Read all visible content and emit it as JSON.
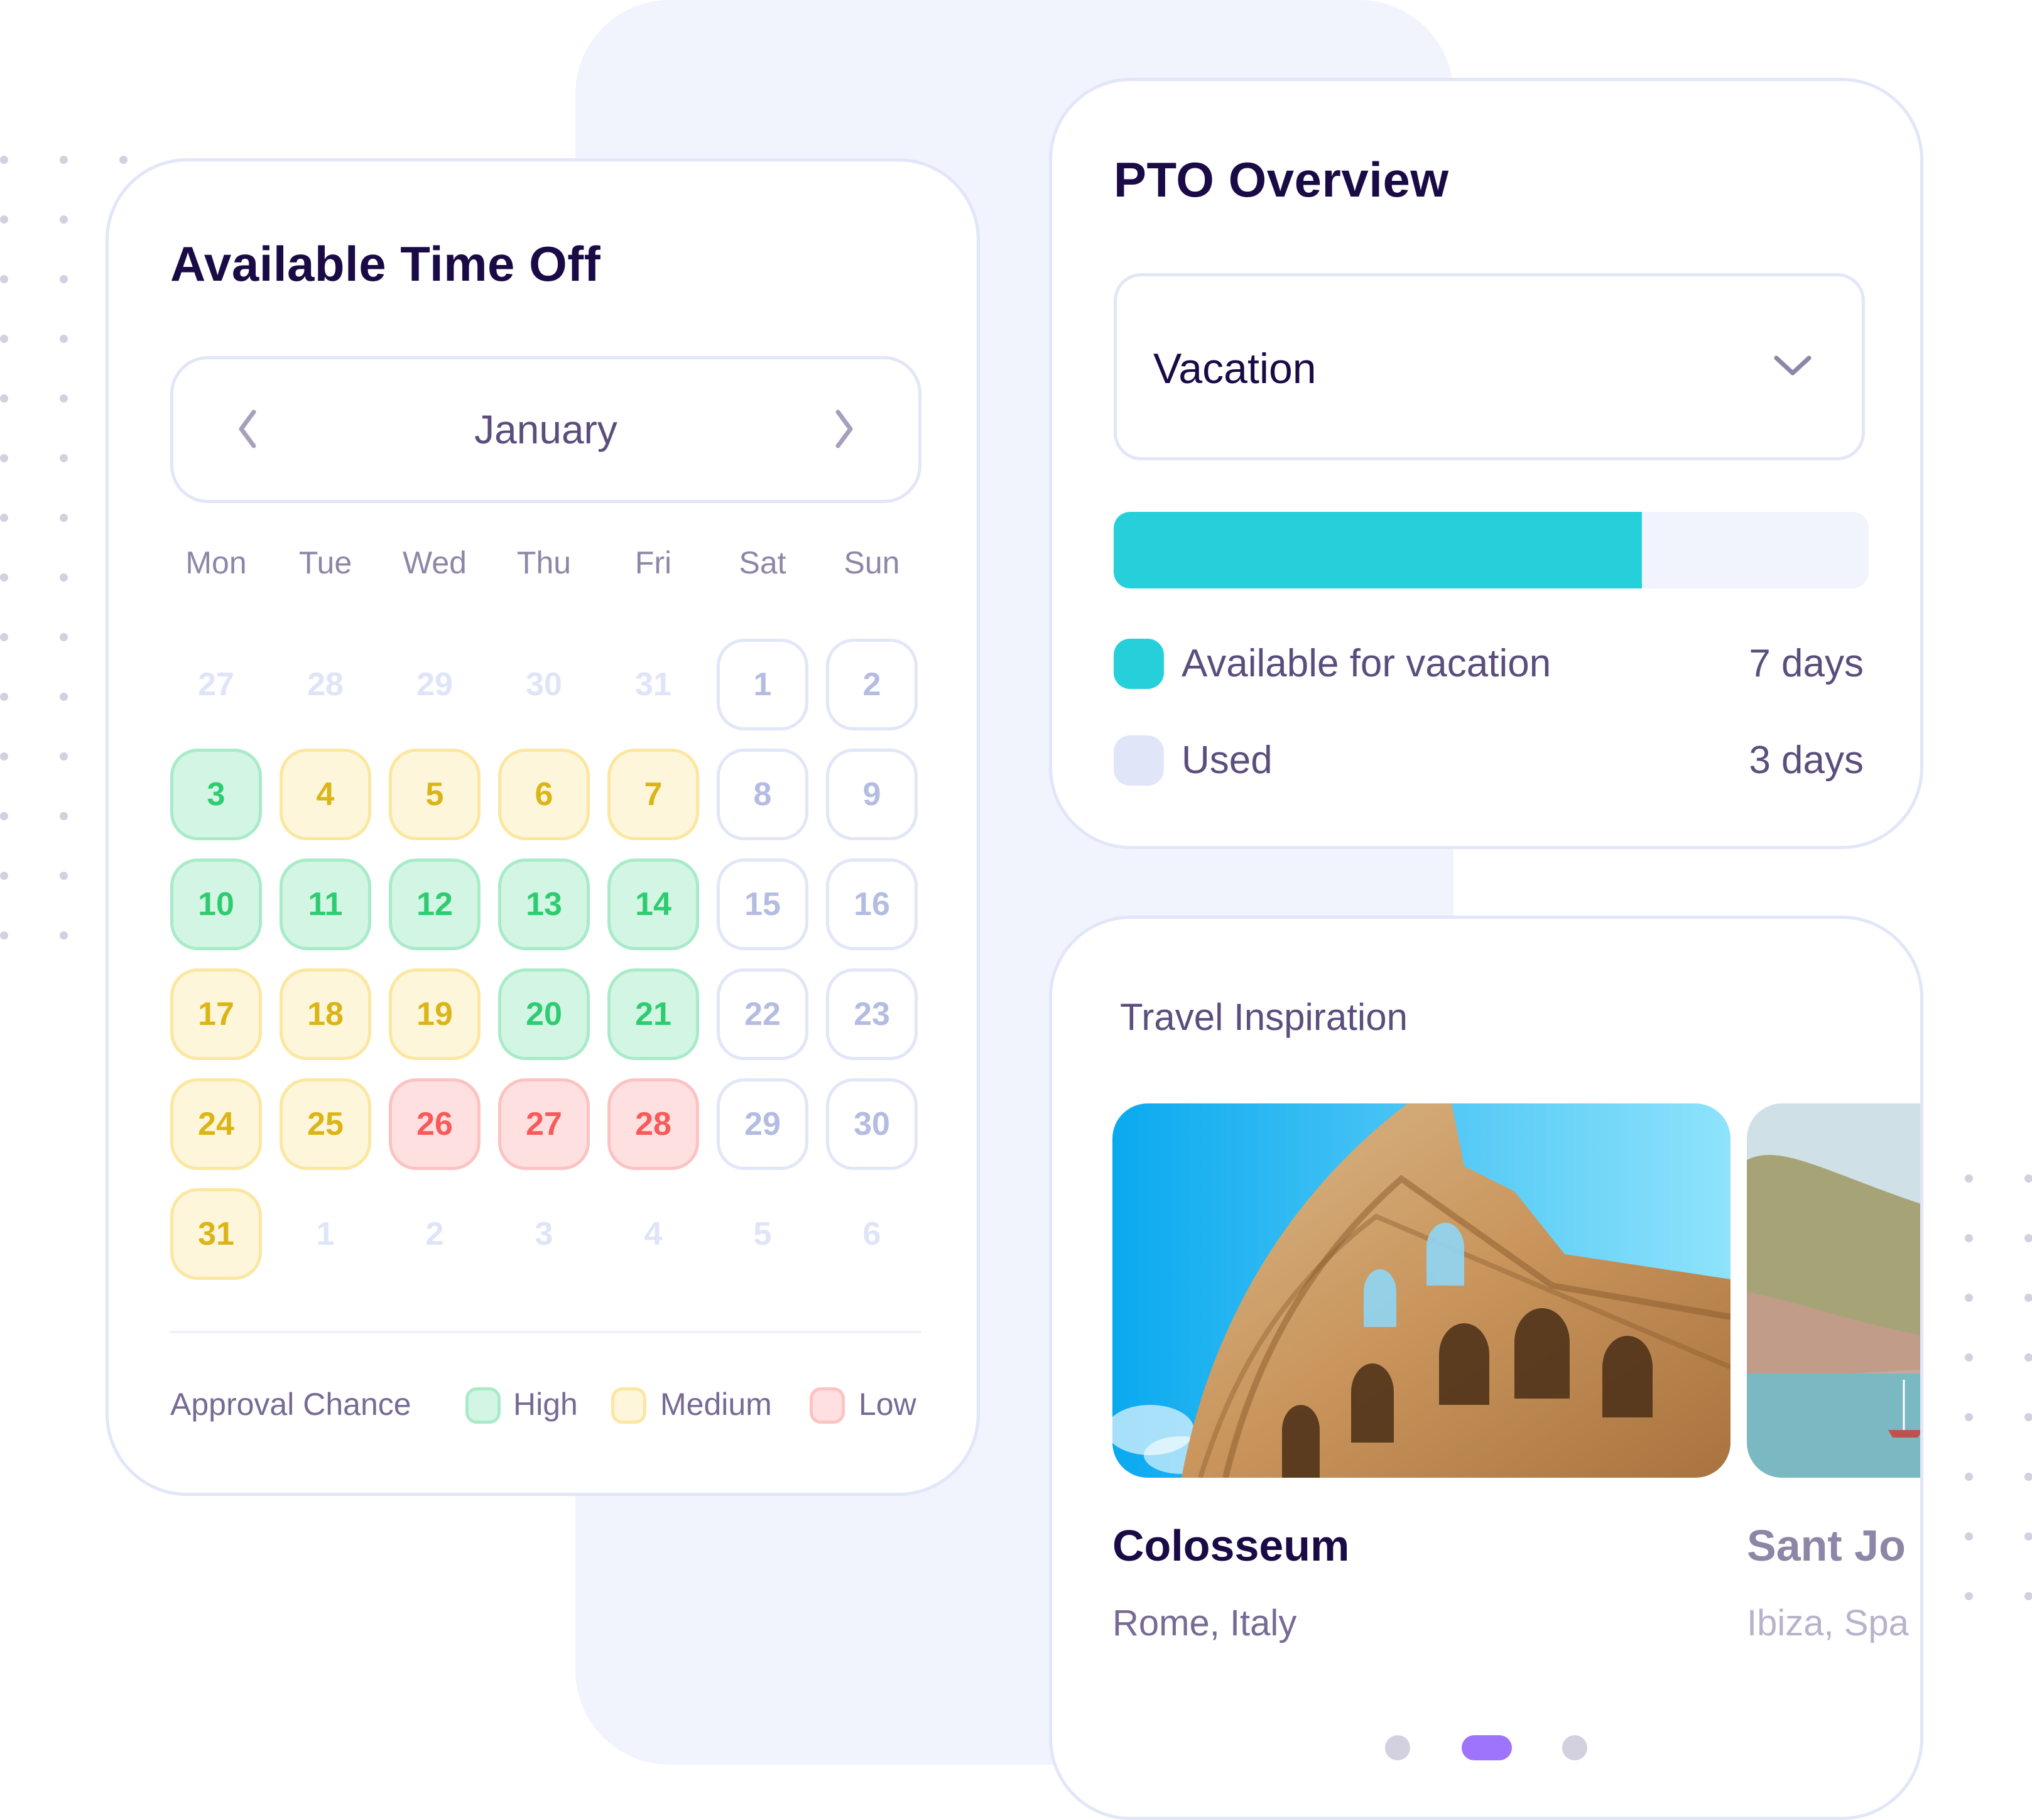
{
  "calendar_card": {
    "title": "Available Time Off",
    "month": "January",
    "prev_icon": "chevron-left-icon",
    "next_icon": "chevron-right-icon",
    "weekdays": [
      "Mon",
      "Tue",
      "Wed",
      "Thu",
      "Fri",
      "Sat",
      "Sun"
    ],
    "weeks": [
      [
        {
          "d": "27",
          "s": "muted"
        },
        {
          "d": "28",
          "s": "muted"
        },
        {
          "d": "29",
          "s": "muted"
        },
        {
          "d": "30",
          "s": "muted"
        },
        {
          "d": "31",
          "s": "muted"
        },
        {
          "d": "1",
          "s": "weekend"
        },
        {
          "d": "2",
          "s": "weekend"
        }
      ],
      [
        {
          "d": "3",
          "s": "high"
        },
        {
          "d": "4",
          "s": "medium"
        },
        {
          "d": "5",
          "s": "medium"
        },
        {
          "d": "6",
          "s": "medium"
        },
        {
          "d": "7",
          "s": "medium"
        },
        {
          "d": "8",
          "s": "weekend"
        },
        {
          "d": "9",
          "s": "weekend"
        }
      ],
      [
        {
          "d": "10",
          "s": "high"
        },
        {
          "d": "11",
          "s": "high"
        },
        {
          "d": "12",
          "s": "high"
        },
        {
          "d": "13",
          "s": "high"
        },
        {
          "d": "14",
          "s": "high"
        },
        {
          "d": "15",
          "s": "weekend"
        },
        {
          "d": "16",
          "s": "weekend"
        }
      ],
      [
        {
          "d": "17",
          "s": "medium"
        },
        {
          "d": "18",
          "s": "medium"
        },
        {
          "d": "19",
          "s": "medium"
        },
        {
          "d": "20",
          "s": "high"
        },
        {
          "d": "21",
          "s": "high"
        },
        {
          "d": "22",
          "s": "weekend"
        },
        {
          "d": "23",
          "s": "weekend"
        }
      ],
      [
        {
          "d": "24",
          "s": "medium"
        },
        {
          "d": "25",
          "s": "medium"
        },
        {
          "d": "26",
          "s": "low"
        },
        {
          "d": "27",
          "s": "low"
        },
        {
          "d": "28",
          "s": "low"
        },
        {
          "d": "29",
          "s": "weekend"
        },
        {
          "d": "30",
          "s": "weekend"
        }
      ],
      [
        {
          "d": "31",
          "s": "medium"
        },
        {
          "d": "1",
          "s": "muted"
        },
        {
          "d": "2",
          "s": "muted"
        },
        {
          "d": "3",
          "s": "muted"
        },
        {
          "d": "4",
          "s": "muted"
        },
        {
          "d": "5",
          "s": "muted"
        },
        {
          "d": "6",
          "s": "muted"
        }
      ]
    ],
    "legend": {
      "title": "Approval Chance",
      "items": [
        {
          "label": "High",
          "level": "high"
        },
        {
          "label": "Medium",
          "level": "medium"
        },
        {
          "label": "Low",
          "level": "low"
        }
      ]
    }
  },
  "pto_card": {
    "title": "PTO Overview",
    "select_value": "Vacation",
    "select_icon": "chevron-down-icon",
    "progress_available_fraction": 0.7,
    "stats": [
      {
        "label": "Available for vacation",
        "value": "7 days",
        "color": "#26d0da"
      },
      {
        "label": "Used",
        "value": "3 days",
        "color": "#e0e5f8"
      }
    ]
  },
  "travel_card": {
    "title": "Travel Inspiration",
    "places": [
      {
        "name": "Colosseum",
        "location": "Rome, Italy",
        "image": "colosseum-photo"
      },
      {
        "name": "Sant Jo",
        "location": "Ibiza, Spa",
        "image": "ibiza-coast-photo"
      }
    ],
    "pager": {
      "count": 3,
      "active_index": 1
    }
  },
  "colors": {
    "title": "#1a0a45",
    "body_text": "#5b4e7d",
    "accent_cyan": "#26d0da",
    "pager_active": "#9d74fb",
    "pager_inactive": "#d3d0df",
    "high": "#2ecc71",
    "medium": "#dbb517",
    "low": "#f85a5a"
  }
}
